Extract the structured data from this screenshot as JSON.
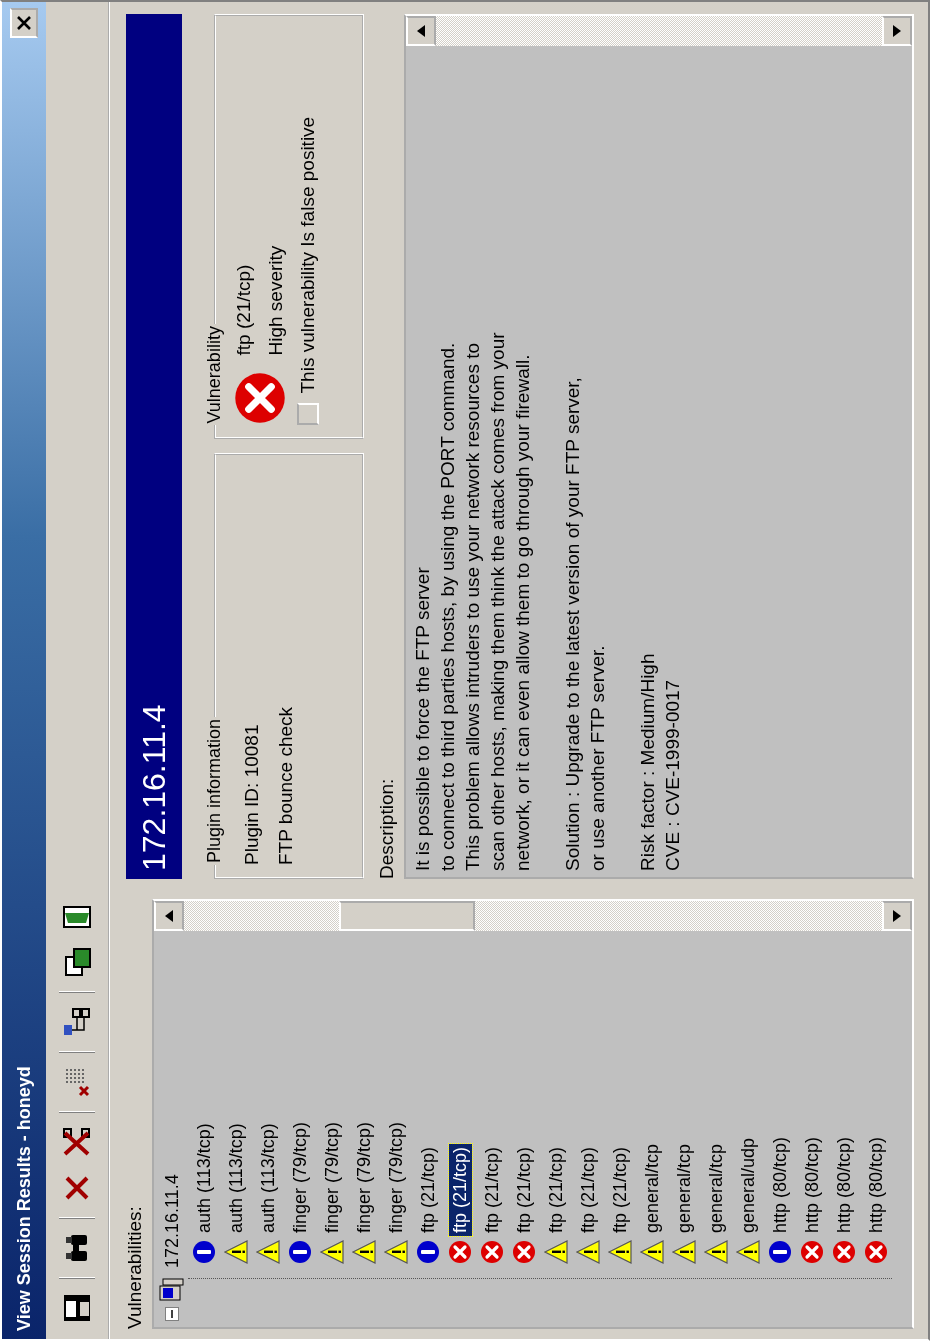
{
  "window": {
    "title": "View Session Results - honeyd"
  },
  "vulnerabilities_label": "Vulnerabilities:",
  "tree": {
    "label": "172.16.11.4",
    "expanded": true,
    "children": [
      {
        "label": "auth (113/tcp)",
        "kind": "info",
        "selected": false
      },
      {
        "label": "auth (113/tcp)",
        "kind": "warning",
        "selected": false
      },
      {
        "label": "auth (113/tcp)",
        "kind": "warning",
        "selected": false
      },
      {
        "label": "finger (79/tcp)",
        "kind": "info",
        "selected": false
      },
      {
        "label": "finger (79/tcp)",
        "kind": "warning",
        "selected": false
      },
      {
        "label": "finger (79/tcp)",
        "kind": "warning",
        "selected": false
      },
      {
        "label": "finger (79/tcp)",
        "kind": "warning",
        "selected": false
      },
      {
        "label": "ftp (21/tcp)",
        "kind": "info",
        "selected": false
      },
      {
        "label": "ftp (21/tcp)",
        "kind": "high",
        "selected": true
      },
      {
        "label": "ftp (21/tcp)",
        "kind": "high",
        "selected": false
      },
      {
        "label": "ftp (21/tcp)",
        "kind": "high",
        "selected": false
      },
      {
        "label": "ftp (21/tcp)",
        "kind": "warning",
        "selected": false
      },
      {
        "label": "ftp (21/tcp)",
        "kind": "warning",
        "selected": false
      },
      {
        "label": "ftp (21/tcp)",
        "kind": "warning",
        "selected": false
      },
      {
        "label": "general/tcp",
        "kind": "warning",
        "selected": false
      },
      {
        "label": "general/tcp",
        "kind": "warning",
        "selected": false
      },
      {
        "label": "general/tcp",
        "kind": "warning",
        "selected": false
      },
      {
        "label": "general/udp",
        "kind": "warning",
        "selected": false
      },
      {
        "label": "http (80/tcp)",
        "kind": "info",
        "selected": false
      },
      {
        "label": "http (80/tcp)",
        "kind": "high",
        "selected": false
      },
      {
        "label": "http (80/tcp)",
        "kind": "high",
        "selected": false
      },
      {
        "label": "http (80/tcp)",
        "kind": "high",
        "selected": false
      }
    ]
  },
  "host_header": "172.16.11.4",
  "plugin_information": {
    "legend": "Plugin information",
    "plugin_id": "Plugin ID: 10081",
    "name": "FTP bounce check"
  },
  "vulnerability": {
    "legend": "Vulnerability",
    "kind": "high",
    "port": "ftp (21/tcp)",
    "severity_label": "High severity",
    "false_positive": {
      "label": "This vulnerability Is false positive",
      "checked": false
    }
  },
  "description_label": "Description:",
  "description": [
    "It is possible to force the FTP server\nto connect to third parties hosts, by using the PORT command.\nThis problem allows intruders to use your network resources to\nscan other hosts, making them think the attack comes from your\nnetwork, or it can even allow them to go through your firewall.",
    "Solution : Upgrade to the latest version of your FTP server,\nor use another FTP server.",
    "Risk factor : Medium/High\nCVE : CVE-1999-0017"
  ]
}
